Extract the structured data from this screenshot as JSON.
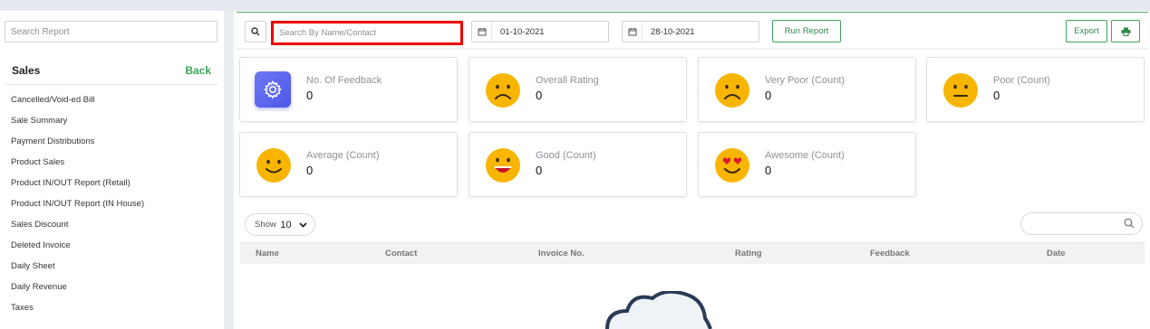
{
  "sidebar": {
    "search_placeholder": "Search Report",
    "section_title": "Sales",
    "back_label": "Back",
    "items": [
      {
        "label": "Cancelled/Void-ed Bill"
      },
      {
        "label": "Sale Summary"
      },
      {
        "label": "Payment Distributions"
      },
      {
        "label": "Product Sales"
      },
      {
        "label": "Product IN/OUT Report (Retail)"
      },
      {
        "label": "Product IN/OUT Report (IN House)"
      },
      {
        "label": "Sales Discount"
      },
      {
        "label": "Deleted Invoice"
      },
      {
        "label": "Daily Sheet"
      },
      {
        "label": "Daily Revenue"
      },
      {
        "label": "Taxes"
      }
    ]
  },
  "toolbar": {
    "search_placeholder": "Search By Name/Contact",
    "date_from": "01-10-2021",
    "date_to": "28-10-2021",
    "run_label": "Run Report",
    "export_label": "Export"
  },
  "cards": [
    {
      "label": "No. Of Feedback",
      "value": "0",
      "icon": "gear-icon"
    },
    {
      "label": "Overall Rating",
      "value": "0",
      "icon": "sad-face-icon"
    },
    {
      "label": "Very Poor (Count)",
      "value": "0",
      "icon": "sad-face-icon"
    },
    {
      "label": "Poor (Count)",
      "value": "0",
      "icon": "neutral-face-icon"
    },
    {
      "label": "Average (Count)",
      "value": "0",
      "icon": "smile-face-icon"
    },
    {
      "label": "Good (Count)",
      "value": "0",
      "icon": "grin-face-icon"
    },
    {
      "label": "Awesome (Count)",
      "value": "0",
      "icon": "heart-eyes-face-icon"
    }
  ],
  "table": {
    "show_label": "Show",
    "show_value": "10",
    "columns": [
      "Name",
      "Contact",
      "Invoice No.",
      "Rating",
      "Feedback",
      "Date"
    ]
  },
  "colors": {
    "accent_green": "#3ea55a",
    "highlight_red": "#ee0000",
    "emoji_yellow": "#f7b500",
    "gear_blue": "#5560ec"
  }
}
